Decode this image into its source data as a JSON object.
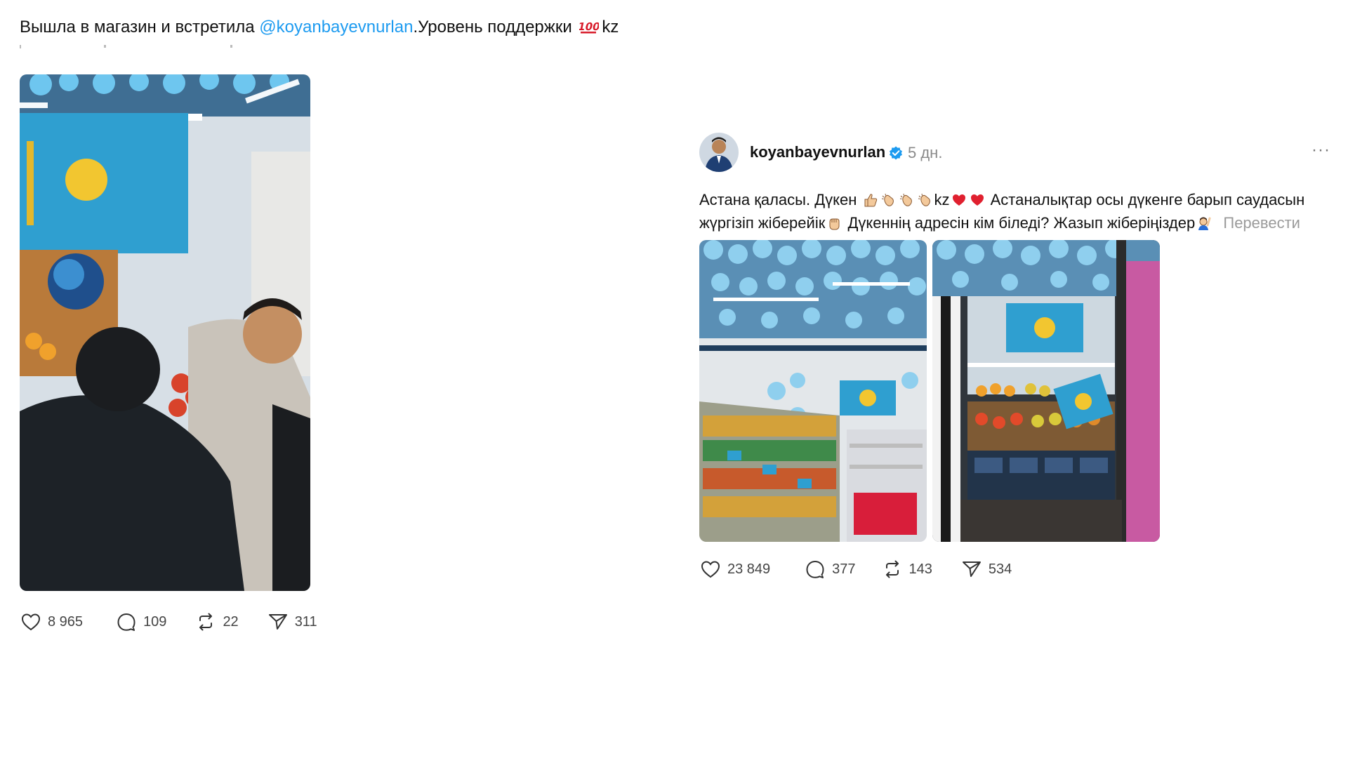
{
  "left_post": {
    "caption_before": "Вышла в магазин и встретила ",
    "mention": "@koyanbayevnurlan",
    "caption_after": ".Уровень поддержки",
    "caption_tail": "kz",
    "actions": {
      "likes": "8 965",
      "comments": "109",
      "reposts": "22",
      "shares": "311"
    }
  },
  "right_post": {
    "username": "koyanbayevnurlan",
    "time": "5 дн.",
    "line1_a": "Астана қаласы. Дүкен",
    "line1_kz": "kz",
    "line1_b": " Астаналықтар осы дүкенге барып саудасын",
    "line2_a": "жүргізіп жіберейік",
    "line2_b": " Дүкеннің адресін кім біледі? Жазып жіберіңіздер",
    "translate": "Перевести",
    "actions": {
      "likes": "23 849",
      "comments": "377",
      "reposts": "143",
      "shares": "534"
    }
  }
}
